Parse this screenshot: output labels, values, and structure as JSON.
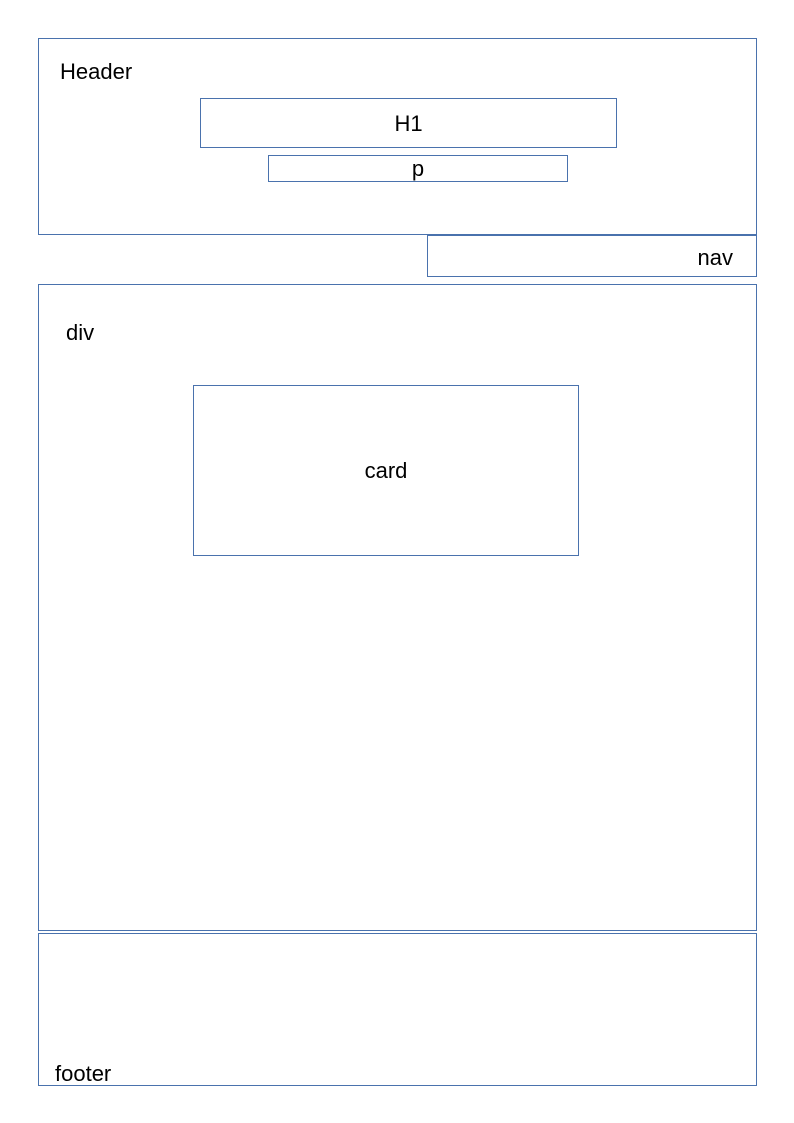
{
  "header": {
    "label": "Header",
    "h1_label": "H1",
    "p_label": "p"
  },
  "nav": {
    "label": "nav"
  },
  "main": {
    "label": "div",
    "card_label": "card"
  },
  "footer": {
    "label": "footer"
  },
  "colors": {
    "border": "#4a72ad",
    "background": "#ffffff",
    "text": "#000000"
  }
}
